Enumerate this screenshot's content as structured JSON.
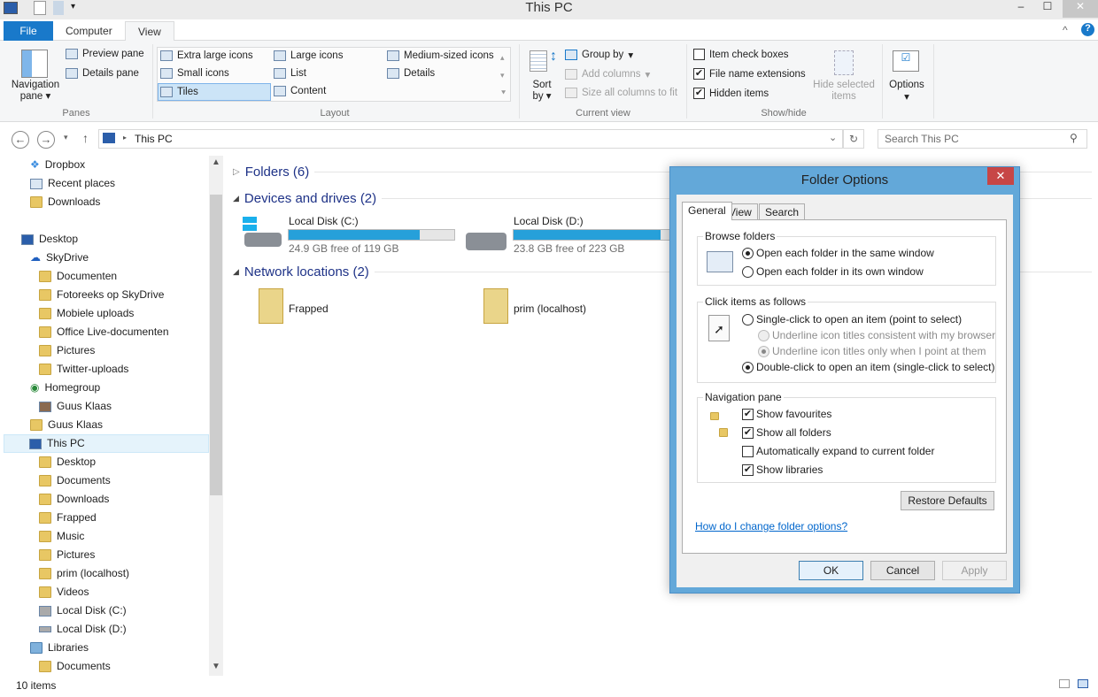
{
  "window": {
    "title": "This PC"
  },
  "tabs": {
    "file": "File",
    "computer": "Computer",
    "view": "View"
  },
  "ribbon": {
    "panes": {
      "navigation_pane": "Navigation pane",
      "preview_pane": "Preview pane",
      "details_pane": "Details pane",
      "label": "Panes"
    },
    "layout": {
      "items": [
        "Extra large icons",
        "Large icons",
        "Medium-sized icons",
        "Small icons",
        "List",
        "Details",
        "Tiles",
        "Content"
      ],
      "selected": "Tiles",
      "label": "Layout"
    },
    "current_view": {
      "sort_by": "Sort by",
      "group_by": "Group by",
      "add_columns": "Add columns",
      "size_columns": "Size all columns to fit",
      "label": "Current view"
    },
    "show_hide": {
      "item_check_boxes": {
        "label": "Item check boxes",
        "checked": false
      },
      "file_name_extensions": {
        "label": "File name extensions",
        "checked": true
      },
      "hidden_items": {
        "label": "Hidden items",
        "checked": true
      },
      "hide_selected": "Hide selected items",
      "label": "Show/hide"
    },
    "options": "Options"
  },
  "address": {
    "path": "This PC",
    "search_placeholder": "Search This PC"
  },
  "sidebar": {
    "items": [
      "Dropbox",
      "Recent places",
      "Downloads",
      "Desktop",
      "SkyDrive",
      "Documenten",
      "Fotoreeks op SkyDrive",
      "Mobiele uploads",
      "Office Live-documenten",
      "Pictures",
      "Twitter-uploads",
      "Homegroup",
      "Guus Klaas",
      "Guus Klaas",
      "This PC",
      "Desktop",
      "Documents",
      "Downloads",
      "Frapped",
      "Music",
      "Pictures",
      "prim (localhost)",
      "Videos",
      "Local Disk (C:)",
      "Local Disk (D:)",
      "Libraries",
      "Documents"
    ]
  },
  "content": {
    "folders": "Folders (6)",
    "devices": "Devices and drives (2)",
    "drives": [
      {
        "name": "Local Disk (C:)",
        "free": "24.9 GB free of 119 GB",
        "used_pct": 79
      },
      {
        "name": "Local Disk (D:)",
        "free": "23.8 GB free of 223 GB",
        "used_pct": 89
      }
    ],
    "network": "Network locations (2)",
    "network_items": [
      "Frapped",
      "prim (localhost)"
    ]
  },
  "status": {
    "count": "10 items"
  },
  "dialog": {
    "title": "Folder Options",
    "tabs": [
      "General",
      "View",
      "Search"
    ],
    "browse": {
      "label": "Browse folders",
      "opt1": "Open each folder in the same window",
      "opt2": "Open each folder in its own window"
    },
    "click": {
      "label": "Click items as follows",
      "single": "Single-click to open an item (point to select)",
      "u1": "Underline icon titles consistent with my browser",
      "u2": "Underline icon titles only when I point at them",
      "double": "Double-click to open an item (single-click to select)"
    },
    "nav": {
      "label": "Navigation pane",
      "o1": "Show favourites",
      "o2": "Show all folders",
      "o3": "Automatically expand to current folder",
      "o4": "Show libraries"
    },
    "restore": "Restore Defaults",
    "help_link": "How do I change folder options?",
    "ok": "OK",
    "cancel": "Cancel",
    "apply": "Apply"
  }
}
